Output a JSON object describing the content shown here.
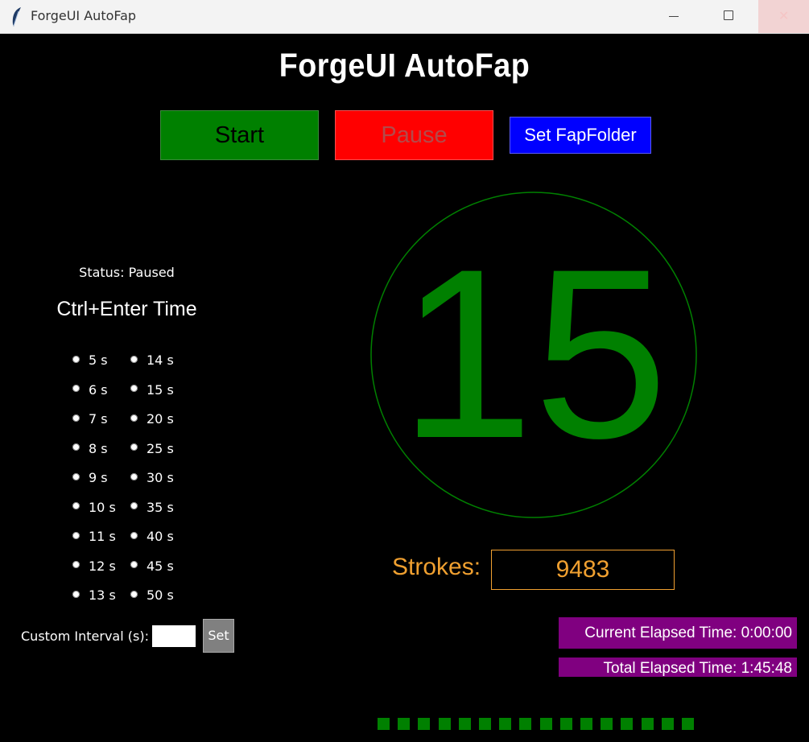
{
  "window": {
    "title": "ForgeUI AutoFap",
    "minimize_icon": "minimize-icon",
    "maximize_icon": "maximize-icon",
    "close_icon": "close-icon",
    "close_glyph": "✕"
  },
  "header": {
    "title": "ForgeUI AutoFap"
  },
  "controls": {
    "start_label": "Start",
    "pause_label": "Pause",
    "folder_label": "Set FapFolder"
  },
  "status": {
    "text": "Status: Paused"
  },
  "interval": {
    "title": "Ctrl+Enter Time",
    "column1": [
      "5 s",
      "6 s",
      "7 s",
      "8 s",
      "9 s",
      "10 s",
      "11 s",
      "12 s",
      "13 s"
    ],
    "column2": [
      "14 s",
      "15 s",
      "20 s",
      "25 s",
      "30 s",
      "35 s",
      "40 s",
      "45 s",
      "50 s"
    ],
    "custom_label": "Custom Interval (s):",
    "custom_value": "",
    "set_label": "Set"
  },
  "counter": {
    "value": "15",
    "color": "#008000"
  },
  "strokes": {
    "label": "Strokes:",
    "value": "9483",
    "color": "#f0a030"
  },
  "elapsed": {
    "current": "Current Elapsed Time: 0:00:00",
    "total": "Total Elapsed Time: 1:45:48"
  },
  "progress": {
    "filled": 16,
    "color": "#008000"
  },
  "colors": {
    "start": "#008000",
    "pause": "#ff0000",
    "folder": "#0000ff",
    "elapsed_bg": "#800080"
  }
}
